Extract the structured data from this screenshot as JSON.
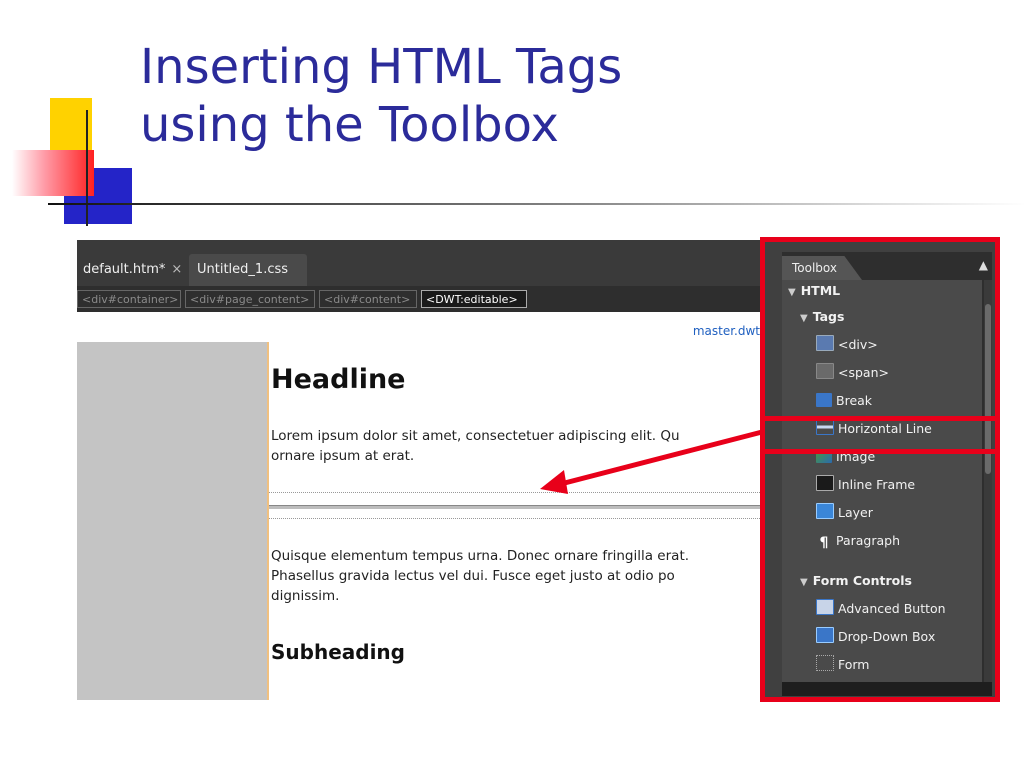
{
  "slide": {
    "title_line1": "Inserting HTML Tags",
    "title_line2": "using the Toolbox"
  },
  "editor": {
    "tabs": [
      {
        "label": "default.htm*",
        "close": "×"
      },
      {
        "label": "Untitled_1.css"
      }
    ],
    "breadcrumbs": [
      "<div#container>",
      "<div#page_content>",
      "<div#content>",
      "<DWT:editable>"
    ],
    "master_link": "master.dwt",
    "headline": "Headline",
    "para1_line1": "Lorem ipsum dolor sit amet, consectetuer adipiscing elit. Qu",
    "para1_line2": "ornare ipsum at erat.",
    "para2_line1": "Quisque elementum tempus urna. Donec ornare fringilla erat.",
    "para2_line2": "Phasellus gravida lectus vel dui. Fusce eget justo at odio po",
    "para2_line3": "dignissim.",
    "subheading": "Subheading"
  },
  "toolbox": {
    "title": "Toolbox",
    "pin_icon": "pin-icon",
    "sections": [
      {
        "label": "HTML",
        "level": 0
      },
      {
        "label": "Tags",
        "level": 1
      },
      {
        "label": "<div>",
        "level": 2,
        "icon": "div-icon"
      },
      {
        "label": "<span>",
        "level": 2,
        "icon": "span-icon"
      },
      {
        "label": "Break",
        "level": 2,
        "icon": "break-icon"
      },
      {
        "label": "Horizontal Line",
        "level": 2,
        "icon": "horizontal-line-icon"
      },
      {
        "label": "Image",
        "level": 2,
        "icon": "image-icon"
      },
      {
        "label": "Inline Frame",
        "level": 2,
        "icon": "inline-frame-icon"
      },
      {
        "label": "Layer",
        "level": 2,
        "icon": "layer-icon"
      },
      {
        "label": "Paragraph",
        "level": 2,
        "icon": "paragraph-icon"
      },
      {
        "label": "Form Controls",
        "level": 1
      },
      {
        "label": "Advanced Button",
        "level": 2,
        "icon": "advanced-button-icon"
      },
      {
        "label": "Drop-Down Box",
        "level": 2,
        "icon": "drop-down-box-icon"
      },
      {
        "label": "Form",
        "level": 2,
        "icon": "form-icon"
      }
    ]
  },
  "colors": {
    "title": "#2b2b9a",
    "highlight": "#e8001a",
    "toolbox_bg": "#4a4a4a"
  }
}
